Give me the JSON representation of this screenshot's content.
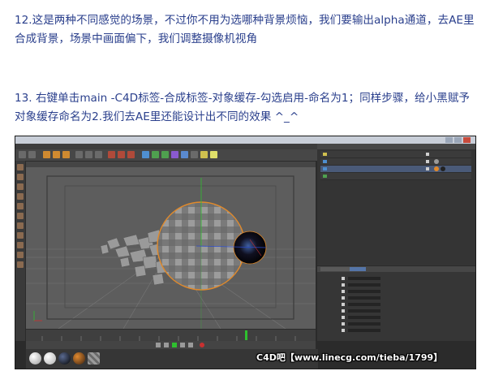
{
  "article": {
    "step12": "12.这是两种不同感觉的场景，不过你不用为选哪种背景烦恼，我们要输出alpha通道，去AE里合成背景，场景中画面偏下，我们调整摄像机视角",
    "step13": "13. 右键单击main -C4D标签-合成标签-对象缓存-勾选启用-命名为1；同样步骤，给小黑赋予对象缓存命名为2.我们去AE里还能设计出不同的效果 ^_^"
  },
  "screenshot": {
    "watermark": "C4D吧【www.linecg.com/tieba/1799】",
    "colors": {
      "ui_dark": "#2b2b2b",
      "viewport_bg": "#5d5d5d",
      "selection_orange": "#e28a2a",
      "active_tab_blue": "#5575a8",
      "axis_green": "#2ec02e",
      "axis_red": "#d03030"
    },
    "icons": [
      "window-minimize-icon",
      "window-maximize-icon",
      "window-close-icon",
      "toolbar-tool-icons",
      "left-tool-icons",
      "material-ball-icons",
      "camera-icon",
      "playhead-icon"
    ]
  }
}
